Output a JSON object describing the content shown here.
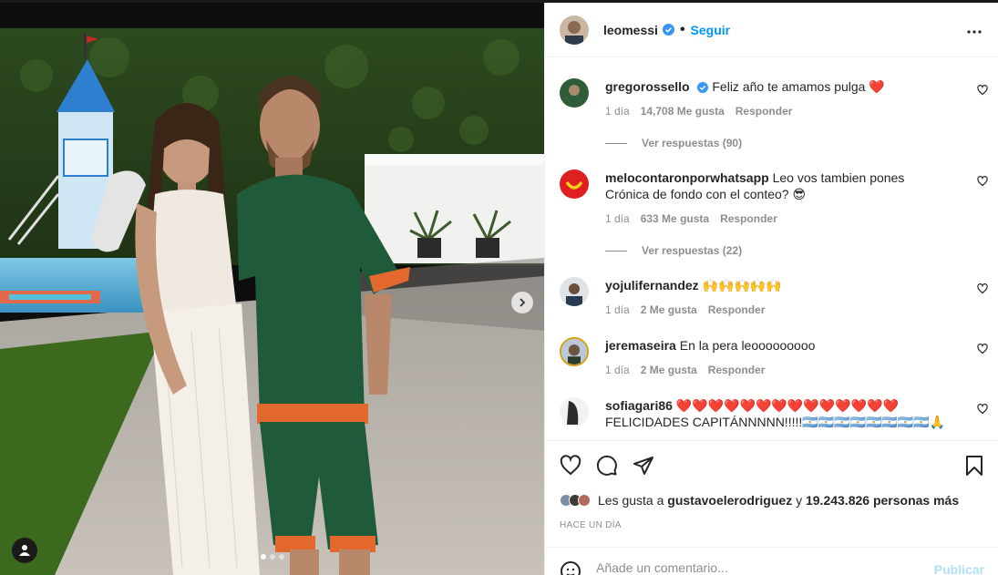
{
  "post": {
    "username": "leomessi",
    "follow_label": "Seguir",
    "separator": "•"
  },
  "comments": [
    {
      "user": "gregorossello",
      "verified": true,
      "text": "Feliz año te amamos pulga ❤️",
      "time": "1 día",
      "likes": "14,708 Me gusta",
      "reply": "Responder",
      "view_replies": "Ver respuestas (90)"
    },
    {
      "user": "melocontaronporwhatsapp",
      "verified": false,
      "text": "Leo vos tambien pones Crónica de fondo con el conteo? 😎",
      "time": "1 día",
      "likes": "633 Me gusta",
      "reply": "Responder",
      "view_replies": "Ver respuestas (22)"
    },
    {
      "user": "yojulifernandez",
      "verified": false,
      "text": "🙌🙌🙌🙌🙌",
      "time": "1 día",
      "likes": "2 Me gusta",
      "reply": "Responder"
    },
    {
      "user": "jeremaseira",
      "verified": false,
      "text": "En la pera leooooooooo",
      "time": "1 día",
      "likes": "2 Me gusta",
      "reply": "Responder"
    },
    {
      "user": "sofiagari86",
      "verified": false,
      "text": "❤️❤️❤️❤️❤️❤️❤️❤️❤️❤️❤️❤️❤️❤️ FELICIDADES CAPITÁNNNNN!!!!!🇦🇷🇦🇷🇦🇷🇦🇷🇦🇷🇦🇷🇦🇷🇦🇷🙏"
    }
  ],
  "likes": {
    "prefix": "Les gusta a",
    "user": "gustavoelerodriguez",
    "connector": "y",
    "others": "19.243.826 personas más"
  },
  "timestamp": "HACE UN DÍA",
  "add_comment": {
    "placeholder": "Añade un comentario...",
    "publish_label": "Publicar"
  },
  "icons": [
    "heart-icon",
    "comment-icon",
    "share-icon",
    "bookmark-icon",
    "more-options-icon",
    "verified-icon",
    "emoji-icon",
    "tag-user-icon",
    "chevron-right-icon"
  ],
  "colors": {
    "accent": "#0095f6",
    "verified": "#3897f0",
    "publish_disabled": "#b2dffc",
    "muted": "#8e8e8e",
    "heart_emoji": "#e0245e"
  }
}
